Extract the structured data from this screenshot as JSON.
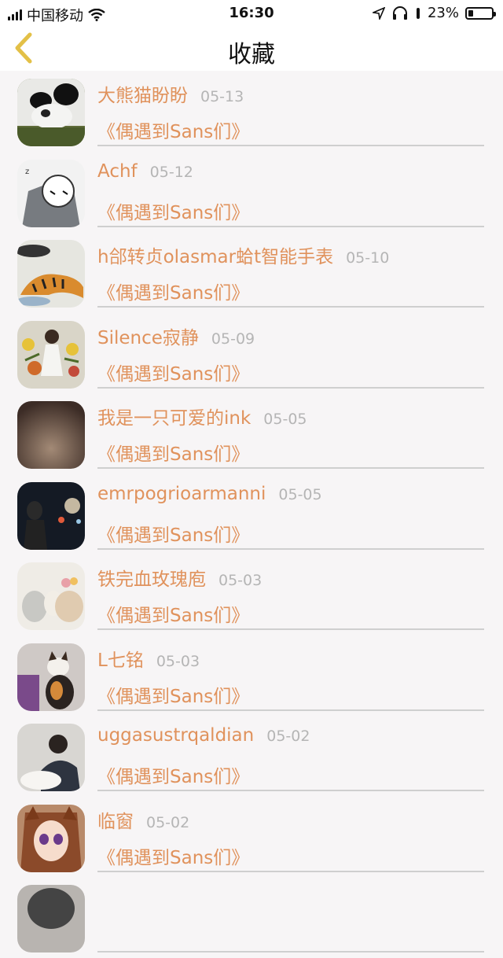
{
  "status_bar": {
    "carrier": "中国移动",
    "time": "16:30",
    "battery_percent": "23%",
    "battery_level": 0.23
  },
  "nav": {
    "title": "收藏",
    "back_icon": "chevron-left-icon",
    "accent_color": "#e3c047"
  },
  "colors": {
    "name": "#e0925c",
    "date": "#b5b5b5",
    "divider": "#cfcfcf",
    "background": "#f7f5f6"
  },
  "favorites": [
    {
      "name": "大熊猫盼盼",
      "date": "05-13",
      "title": "《偶遇到Sans们》",
      "avatar": "panda-avatar"
    },
    {
      "name": "Achf",
      "date": "05-12",
      "title": "《偶遇到Sans们》",
      "avatar": "anime-sketch-avatar"
    },
    {
      "name": "h郃转贞olasmar蛤t智能手表",
      "date": "05-10",
      "title": "《偶遇到Sans们》",
      "avatar": "tiger-avatar"
    },
    {
      "name": "Silence寂静",
      "date": "05-09",
      "title": "《偶遇到Sans们》",
      "avatar": "girl-flowers-avatar"
    },
    {
      "name": "我是一只可爱的ink",
      "date": "05-05",
      "title": "《偶遇到Sans们》",
      "avatar": "blurry-brown-avatar"
    },
    {
      "name": "emrpogrioarmanni",
      "date": "05-05",
      "title": "《偶遇到Sans们》",
      "avatar": "night-street-avatar"
    },
    {
      "name": "铁完血玫瑰庖",
      "date": "05-03",
      "title": "《偶遇到Sans们》",
      "avatar": "plush-toys-avatar"
    },
    {
      "name": "L七铭",
      "date": "05-03",
      "title": "《偶遇到Sans们》",
      "avatar": "cat-avatar"
    },
    {
      "name": "uggasustrqaldian",
      "date": "05-02",
      "title": "《偶遇到Sans们》",
      "avatar": "man-with-dog-avatar"
    },
    {
      "name": "临窗",
      "date": "05-02",
      "title": "《偶遇到Sans们》",
      "avatar": "anime-girl-avatar"
    },
    {
      "name": "",
      "date": "",
      "title": "",
      "avatar": "partial-avatar"
    }
  ]
}
